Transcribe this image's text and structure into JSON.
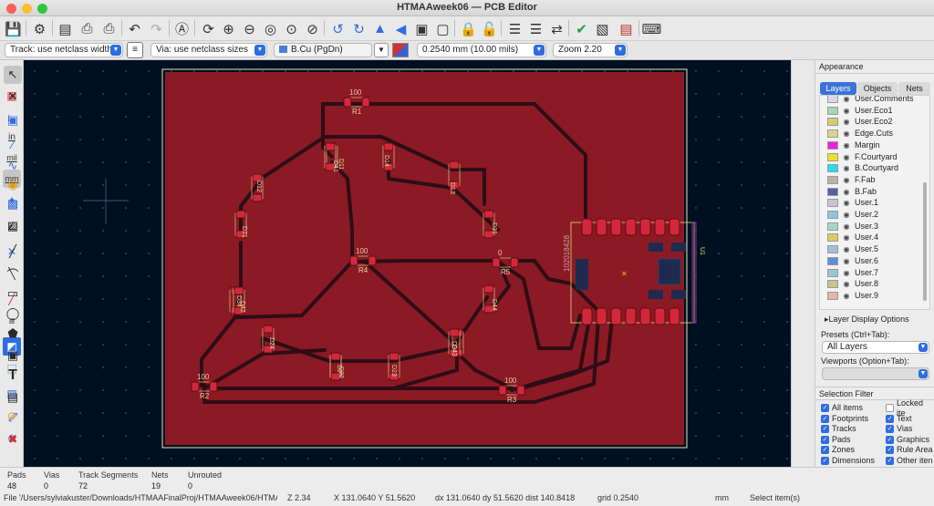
{
  "window": {
    "title": "HTMAAweek06 — PCB Editor",
    "traffic_colors": [
      "#fe5f57",
      "#febc2e",
      "#28c840"
    ]
  },
  "toolbar2": {
    "track_width": "Track: use netclass width",
    "via_size": "Via: use netclass sizes",
    "layer": "B.Cu (PgDn)",
    "layer_color": "#4a7fd8",
    "grid": "0.2540 mm (10.00 mils)",
    "zoom": "Zoom 2.20"
  },
  "left_toolbar": {
    "items": [
      "grid-dots-icon",
      "polar-grid-icon",
      "measure-icon",
      "units-in-icon",
      "units-mil-icon",
      "units-mm-icon",
      "cursor-shape-icon",
      "ratsnest-icon",
      "curved-ratsnest-icon",
      "zone-fill-icon",
      "zone-outline-icon",
      "pad-sketch-icon",
      "via-sketch-icon",
      "track-sketch-icon",
      "high-contrast-icon",
      "layer-manager-icon",
      "net-inspector-icon"
    ],
    "labels": {
      "in": "in",
      "mil": "mil",
      "mm": "mm"
    }
  },
  "right_toolbar": {
    "items": [
      "select-arrow-icon",
      "local-ratsnest-icon",
      "place-footprint-icon",
      "route-track-icon",
      "tune-length-icon",
      "diff-pair-icon",
      "add-via-icon",
      "add-zone-icon",
      "add-rule-area-icon",
      "draw-line-icon",
      "draw-arc-icon",
      "draw-rect-icon",
      "draw-circle-icon",
      "draw-polygon-icon",
      "add-image-icon",
      "add-text-icon",
      "add-textbox-icon",
      "add-dimension-icon",
      "delete-tool-icon"
    ]
  },
  "appearance": {
    "title": "Appearance",
    "tabs": [
      "Layers",
      "Objects",
      "Nets"
    ],
    "active_tab": "Layers",
    "layers": [
      {
        "name": "User.Comments",
        "color": "#d8d8ea"
      },
      {
        "name": "User.Eco1",
        "color": "#a3d7b8"
      },
      {
        "name": "User.Eco2",
        "color": "#d7cc6c"
      },
      {
        "name": "Edge.Cuts",
        "color": "#d6d68a"
      },
      {
        "name": "Margin",
        "color": "#f020d6"
      },
      {
        "name": "F.Courtyard",
        "color": "#f0dd2a"
      },
      {
        "name": "B.Courtyard",
        "color": "#22e0e8"
      },
      {
        "name": "F.Fab",
        "color": "#b6b6a6"
      },
      {
        "name": "B.Fab",
        "color": "#585fa2"
      },
      {
        "name": "User.1",
        "color": "#c4c4d4"
      },
      {
        "name": "User.2",
        "color": "#8ac6e0"
      },
      {
        "name": "User.3",
        "color": "#a4d7c6"
      },
      {
        "name": "User.4",
        "color": "#d7cf5c"
      },
      {
        "name": "User.5",
        "color": "#a3bedb"
      },
      {
        "name": "User.6",
        "color": "#5d90d6"
      },
      {
        "name": "User.7",
        "color": "#9cc5d9"
      },
      {
        "name": "User.8",
        "color": "#c8c48a"
      },
      {
        "name": "User.9",
        "color": "#e3b5ae"
      }
    ],
    "layer_display_options": "Layer Display Options",
    "presets_label": "Presets (Ctrl+Tab):",
    "presets_value": "All Layers",
    "viewports_label": "Viewports (Option+Tab):",
    "viewports_value": ""
  },
  "selection_filter": {
    "title": "Selection Filter",
    "items": [
      {
        "label": "All items",
        "checked": true
      },
      {
        "label": "Locked ite",
        "checked": false
      },
      {
        "label": "Footprints",
        "checked": true
      },
      {
        "label": "Text",
        "checked": true
      },
      {
        "label": "Tracks",
        "checked": true
      },
      {
        "label": "Vias",
        "checked": true
      },
      {
        "label": "Pads",
        "checked": true
      },
      {
        "label": "Graphics",
        "checked": true
      },
      {
        "label": "Zones",
        "checked": true
      },
      {
        "label": "Rule Area",
        "checked": true
      },
      {
        "label": "Dimensions",
        "checked": true
      },
      {
        "label": "Other iten",
        "checked": true
      }
    ]
  },
  "board": {
    "components": [
      {
        "ref": "R1",
        "value": "100"
      },
      {
        "ref": "R2",
        "value": "100"
      },
      {
        "ref": "R3",
        "value": "100"
      },
      {
        "ref": "R4",
        "value": "100"
      },
      {
        "ref": "R5",
        "value": "0"
      },
      {
        "ref": "D11"
      },
      {
        "ref": "D12"
      },
      {
        "ref": "D13"
      },
      {
        "ref": "D14"
      },
      {
        "ref": "D21"
      },
      {
        "ref": "D22"
      },
      {
        "ref": "D23"
      },
      {
        "ref": "D24"
      },
      {
        "ref": "D31"
      },
      {
        "ref": "D32"
      },
      {
        "ref": "D33"
      },
      {
        "ref": "D34"
      },
      {
        "ref": "D41"
      },
      {
        "ref": "D42"
      },
      {
        "ref": "D43"
      },
      {
        "ref": "D44"
      },
      {
        "ref": "U1"
      }
    ],
    "module_text": "102018428",
    "colors": {
      "background": "#001023",
      "copper": "#8b1a24",
      "pad": "#d4283a",
      "track": "#2e0d16"
    }
  },
  "status": {
    "pads_label": "Pads",
    "pads": "48",
    "vias_label": "Vias",
    "vias": "0",
    "tracks_label": "Track Segments",
    "tracks": "72",
    "nets_label": "Nets",
    "nets": "19",
    "unrouted_label": "Unrouted",
    "unrouted": "0",
    "file": "File '/Users/sylviakuster/Downloads/HTMAAFinalProj/HTMAAweek06/HTMAAweek06",
    "z": "Z 2.34",
    "xy": "X 131.0640  Y 51.5620",
    "dxy": "dx 131.0640  dy 51.5620  dist 140.8418",
    "grid": "grid 0.2540",
    "units": "mm",
    "mode": "Select item(s)"
  }
}
